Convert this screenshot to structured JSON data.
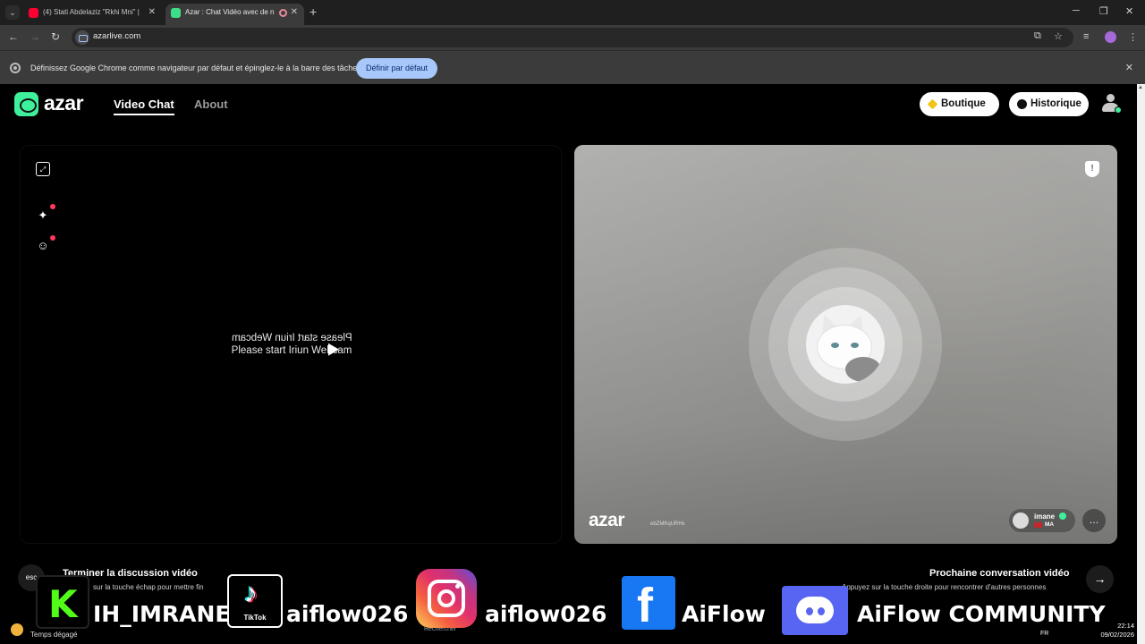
{
  "browser": {
    "tabs": [
      {
        "title": "(4) Stati Abdelaziz \"Rkhi Mni\" |",
        "active": false
      },
      {
        "title": "Azar : Chat Vidéo avec de n",
        "active": true
      }
    ],
    "new_tab_label": "+",
    "url": "azarlive.com",
    "window_controls": {
      "minimize": "─",
      "restore": "❐",
      "close": "✕"
    }
  },
  "infobar": {
    "message": "Définissez Google Chrome comme navigateur par défaut et épinglez-le à la barre des tâches",
    "button": "Définir par défaut",
    "close": "✕"
  },
  "header": {
    "logo_text": "azar",
    "nav": [
      {
        "label": "Video Chat",
        "active": true
      },
      {
        "label": "About",
        "active": false
      }
    ],
    "shop_label": "Boutique",
    "history_label": "Historique"
  },
  "local_video": {
    "message_mirrored": "Please start Iriun Webcam",
    "message": "Please start Iriun Webcam"
  },
  "remote_video": {
    "watermark": "azar",
    "watermark_id": "ebZMKqURHx",
    "peer_name": "imane",
    "peer_country": "MA"
  },
  "hints": {
    "end_title": "Terminer la discussion vidéo",
    "end_sub": "sur la touche échap pour mettre fin",
    "esc_label": "esc",
    "next_title": "Prochaine conversation vidéo",
    "next_sub": "Appuyez sur la touche droite pour rencontrer d'autres personnes"
  },
  "social": {
    "kick_handle": "IH_IMRANE",
    "tiktok_label": "TikTok",
    "tiktok_handle": "aiflow026",
    "instagram_handle": "aiflow026",
    "facebook_handle": "AiFlow",
    "discord_handle": "AiFlow COMMUNITY"
  },
  "taskbar": {
    "weather": "Temps dégagé",
    "search_placeholder": "Rechercher",
    "lang": "FR",
    "time": "22:14",
    "date": "09/02/2026"
  },
  "colors": {
    "brand_green": "#3ef09b",
    "chrome_button": "#a8c7fa",
    "alert_dot": "#ff3b5c"
  }
}
